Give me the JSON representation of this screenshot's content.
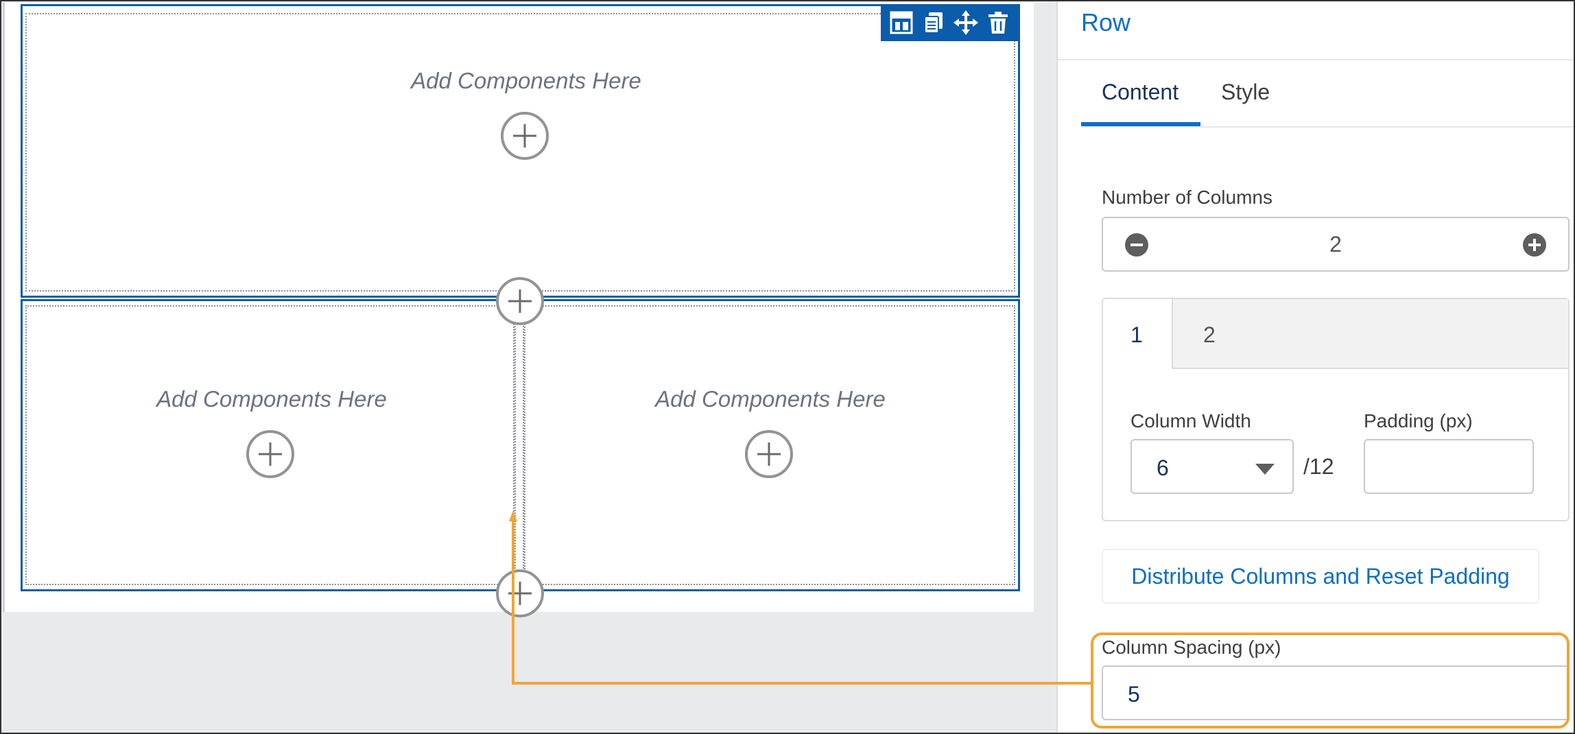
{
  "canvas": {
    "placeholder_text": "Add Components Here",
    "toolbar": {
      "icons": [
        "layout-icon",
        "copy-icon",
        "move-icon",
        "trash-icon"
      ]
    }
  },
  "panel": {
    "title": "Row",
    "tabs": [
      {
        "label": "Content",
        "active": true
      },
      {
        "label": "Style",
        "active": false
      }
    ],
    "number_of_columns": {
      "label": "Number of Columns",
      "value": "2"
    },
    "column_tabs": [
      "1",
      "2"
    ],
    "column_width": {
      "label": "Column Width",
      "value": "6",
      "suffix": "/12"
    },
    "padding": {
      "label": "Padding (px)",
      "value": ""
    },
    "distribute_button": "Distribute Columns and Reset Padding",
    "column_spacing": {
      "label": "Column Spacing (px)",
      "value": "5"
    }
  },
  "colors": {
    "accent": "#0b5cab",
    "link": "#0b6ec8",
    "callout": "#f0a537"
  }
}
